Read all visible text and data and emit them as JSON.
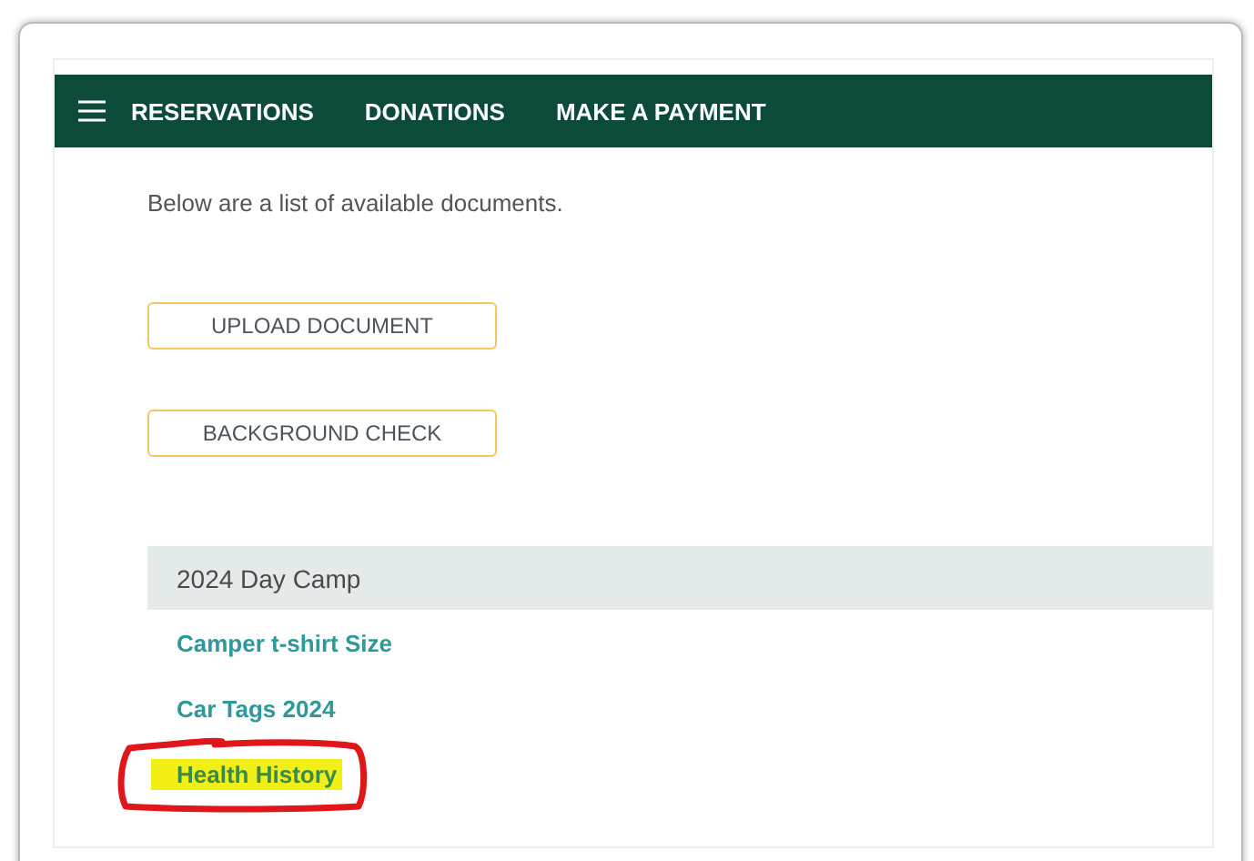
{
  "nav": {
    "items": [
      "RESERVATIONS",
      "DONATIONS",
      "MAKE A PAYMENT"
    ]
  },
  "intro": "Below are a list of available documents.",
  "actions": [
    "UPLOAD DOCUMENT",
    "BACKGROUND CHECK"
  ],
  "groups": [
    {
      "title": "2024 Day Camp",
      "documents": [
        {
          "label": "Camper t-shirt Size",
          "highlighted": false,
          "circled": false
        },
        {
          "label": "Car Tags 2024",
          "highlighted": false,
          "circled": false
        },
        {
          "label": "Health History",
          "highlighted": true,
          "circled": true
        }
      ]
    }
  ]
}
